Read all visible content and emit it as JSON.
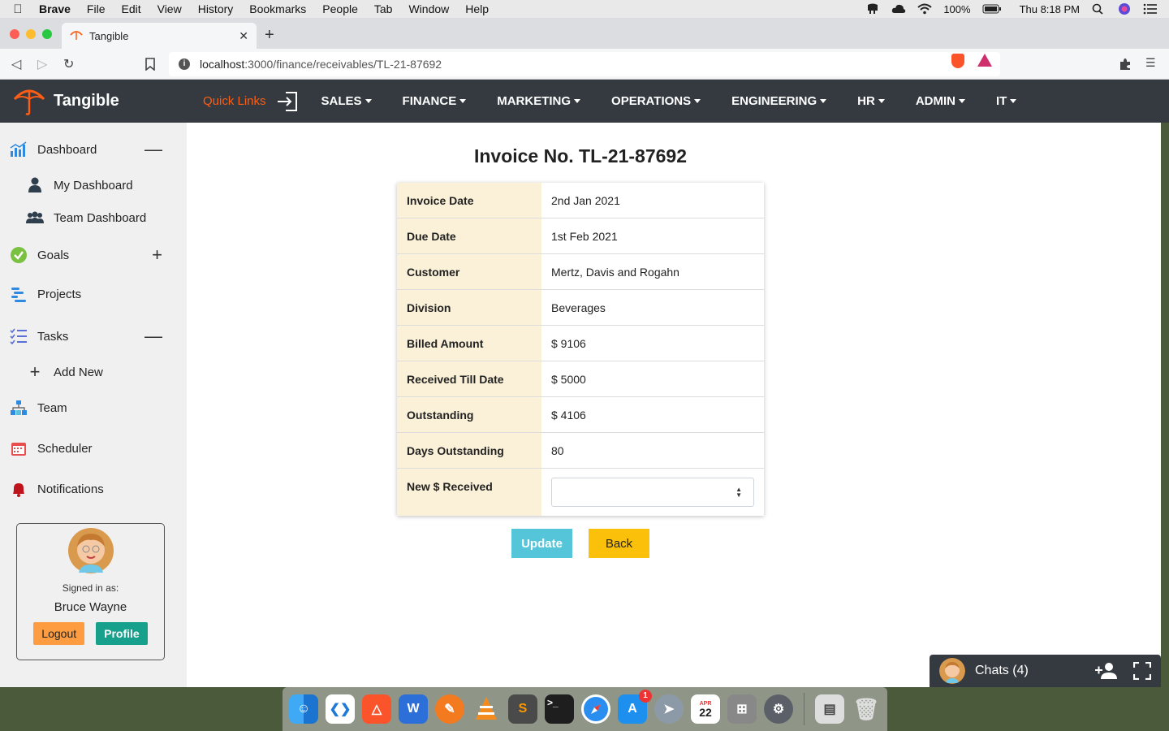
{
  "menubar": {
    "app": "Brave",
    "items": [
      "File",
      "Edit",
      "View",
      "History",
      "Bookmarks",
      "People",
      "Tab",
      "Window",
      "Help"
    ],
    "battery": "100%",
    "clock": "Thu 8:18 PM"
  },
  "browser": {
    "tab_title": "Tangible",
    "url_host": "localhost",
    "url_path": ":3000/finance/receivables/TL-21-87692"
  },
  "appnav": {
    "brand": "Tangible",
    "quick_links": "Quick Links",
    "items": [
      "SALES",
      "FINANCE",
      "MARKETING",
      "OPERATIONS",
      "ENGINEERING",
      "HR",
      "ADMIN",
      "IT"
    ]
  },
  "sidebar": {
    "dashboard": "Dashboard",
    "my_dashboard": "My Dashboard",
    "team_dashboard": "Team Dashboard",
    "goals": "Goals",
    "projects": "Projects",
    "tasks": "Tasks",
    "add_new": "Add New",
    "team": "Team",
    "scheduler": "Scheduler",
    "notifications": "Notifications",
    "user": {
      "signed_in_as": "Signed in as:",
      "name": "Bruce Wayne",
      "logout": "Logout",
      "profile": "Profile"
    }
  },
  "invoice": {
    "title": "Invoice No. TL-21-87692",
    "rows": [
      {
        "label": "Invoice Date",
        "value": "2nd Jan 2021"
      },
      {
        "label": "Due Date",
        "value": "1st Feb 2021"
      },
      {
        "label": "Customer",
        "value": "Mertz, Davis and Rogahn"
      },
      {
        "label": "Division",
        "value": "Beverages"
      },
      {
        "label": "Billed Amount",
        "value": "$ 9106"
      },
      {
        "label": "Received Till Date",
        "value": "$ 5000"
      },
      {
        "label": "Outstanding",
        "value": "$ 4106"
      },
      {
        "label": "Days Outstanding",
        "value": "80"
      }
    ],
    "new_received_label": "New $ Received",
    "new_received_value": "",
    "update": "Update",
    "back": "Back"
  },
  "chats": {
    "label": "Chats (4)"
  },
  "dock": {
    "calendar_month": "APR",
    "calendar_day": "22",
    "appstore_badge": "1"
  }
}
